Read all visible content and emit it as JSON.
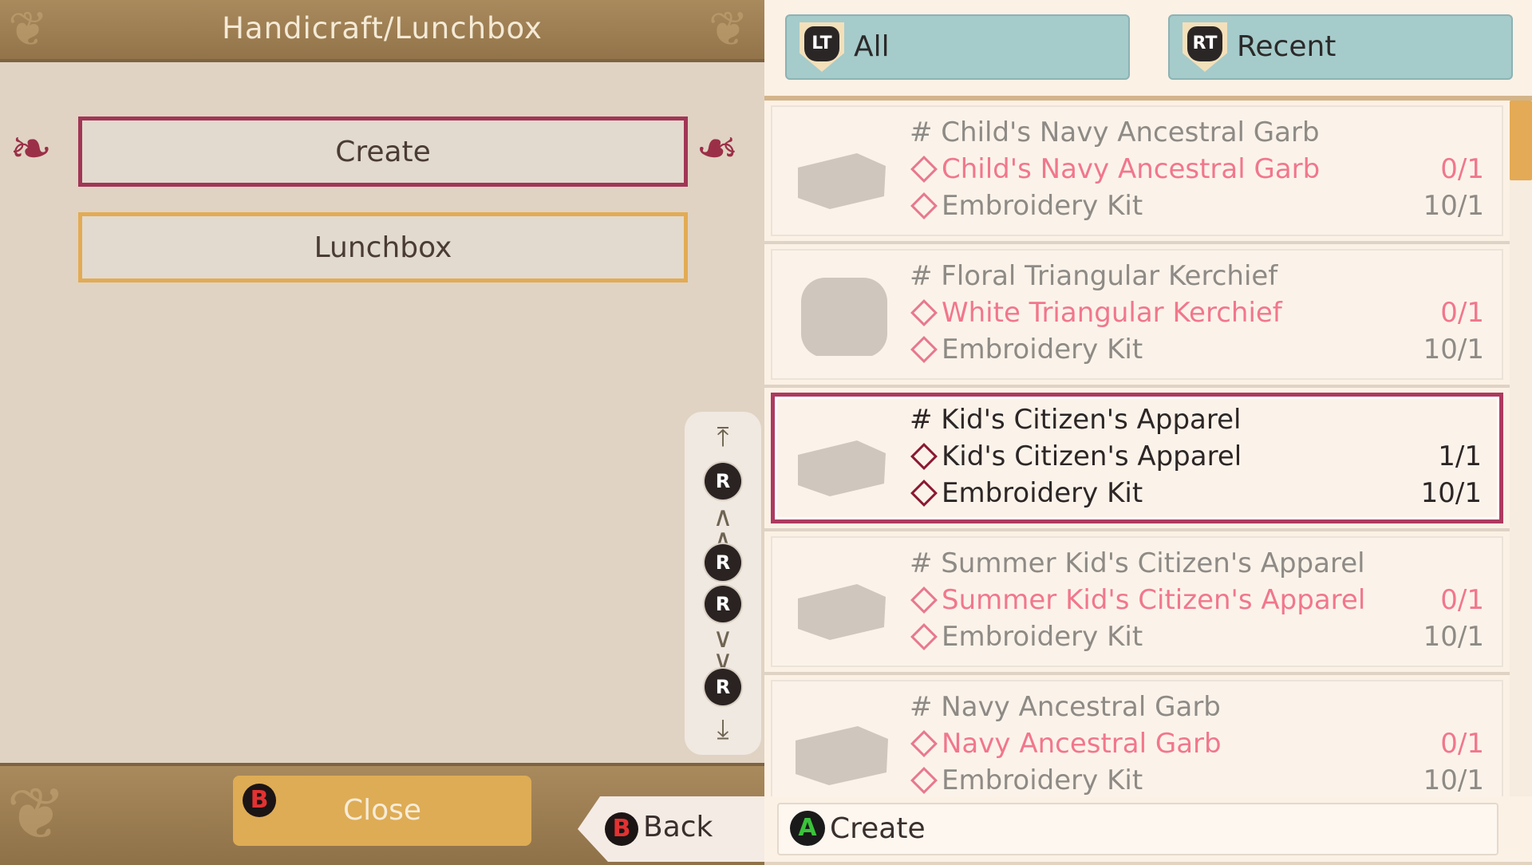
{
  "header": {
    "title": "Handicraft/Lunchbox"
  },
  "menu": {
    "create_label": "Create",
    "lunchbox_label": "Lunchbox"
  },
  "scroll_guide": {
    "button_letter": "R",
    "icons": [
      "scroll-top-icon",
      "r-stick-up-icon",
      "page-up-icon",
      "r-stick-left-icon",
      "r-stick-right-icon",
      "page-down-icon",
      "r-stick-down-icon",
      "scroll-bottom-icon"
    ]
  },
  "footer": {
    "close_button_letter": "B",
    "close_label": "Close",
    "back_button_letter": "B",
    "back_label": "Back"
  },
  "tabs": [
    {
      "trigger": "LT",
      "label": "All"
    },
    {
      "trigger": "RT",
      "label": "Recent"
    }
  ],
  "recipes": [
    {
      "title": "# Child's Navy Ancestral Garb",
      "materials": [
        {
          "name": "Child's Navy Ancestral Garb",
          "qty": "0/1",
          "insufficient": true
        },
        {
          "name": "Embroidery Kit",
          "qty": "10/1",
          "insufficient": false
        }
      ],
      "selected": false
    },
    {
      "title": "# Floral Triangular Kerchief",
      "materials": [
        {
          "name": "White Triangular Kerchief",
          "qty": "0/1",
          "insufficient": true
        },
        {
          "name": "Embroidery Kit",
          "qty": "10/1",
          "insufficient": false
        }
      ],
      "selected": false
    },
    {
      "title": "# Kid's Citizen's Apparel",
      "materials": [
        {
          "name": "Kid's Citizen's Apparel",
          "qty": "1/1",
          "insufficient": false
        },
        {
          "name": "Embroidery Kit",
          "qty": "10/1",
          "insufficient": false
        }
      ],
      "selected": true
    },
    {
      "title": "# Summer Kid's Citizen's Apparel",
      "materials": [
        {
          "name": "Summer Kid's Citizen's Apparel",
          "qty": "0/1",
          "insufficient": true
        },
        {
          "name": "Embroidery Kit",
          "qty": "10/1",
          "insufficient": false
        }
      ],
      "selected": false
    },
    {
      "title": "# Navy Ancestral Garb",
      "materials": [
        {
          "name": "Navy Ancestral Garb",
          "qty": "0/1",
          "insufficient": true
        },
        {
          "name": "Embroidery Kit",
          "qty": "10/1",
          "insufficient": false
        }
      ],
      "selected": false
    }
  ],
  "action_bar": {
    "button_letter": "A",
    "label": "Create"
  },
  "colors": {
    "selection_border": "#ad3a5f",
    "insufficient_text": "#f1778c",
    "header_gold": "#a98a5d",
    "tab_teal": "#a6cbcb",
    "close_button": "#deac55"
  }
}
